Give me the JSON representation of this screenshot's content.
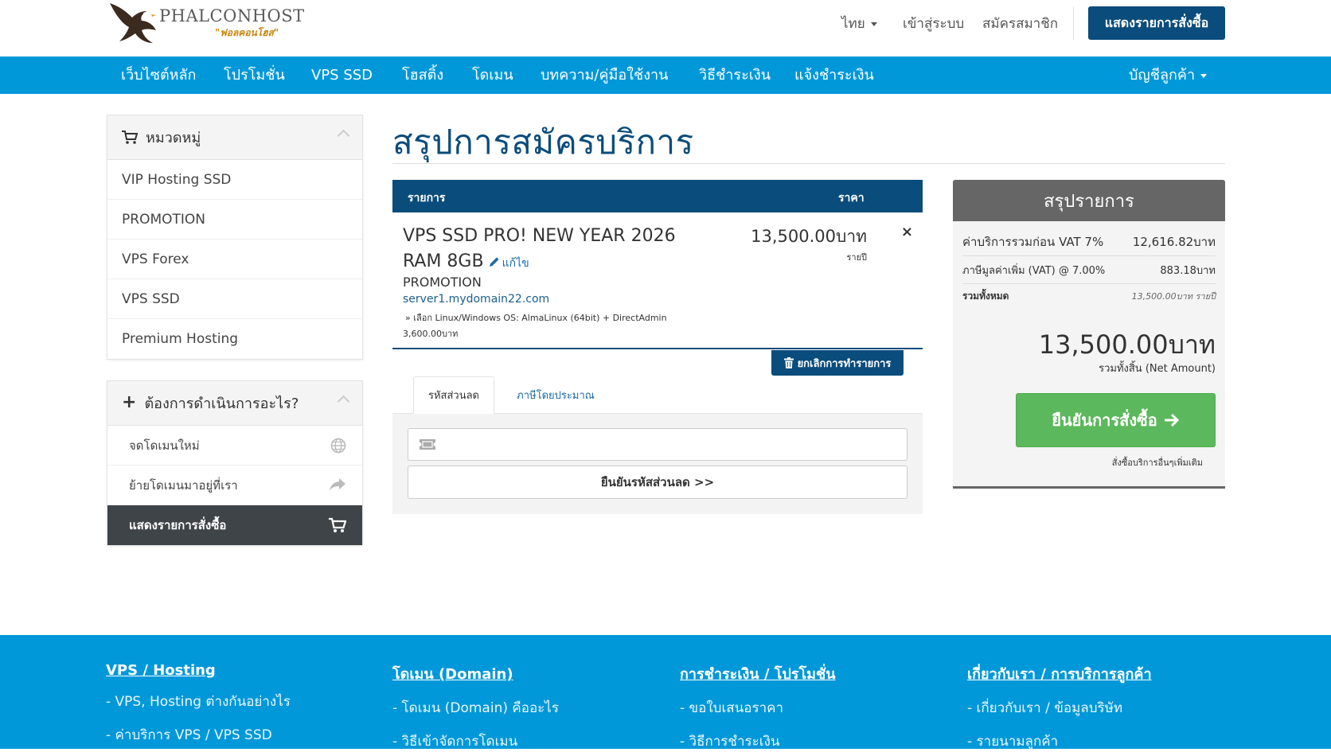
{
  "header": {
    "logo_name": "PHALCONHOST",
    "logo_tagline": "\"ฟอลคอนโฮส\"",
    "language": "ไทย",
    "login": "เข้าสู่ระบบ",
    "register": "สมัครสมาชิก",
    "view_cart": "แสดงรายการสั่งซื้อ"
  },
  "nav": {
    "items": [
      "เว็บไซต์หลัก",
      "โปรโมชั่น",
      "VPS SSD",
      "โฮสติ้ง",
      "โดเมน",
      "บทความ/คู่มือใช้งาน",
      "วิธีชำระเงิน",
      "แจ้งชำระเงิน"
    ],
    "account": "บัญชีลูกค้า"
  },
  "sidebar": {
    "categories_title": "หมวดหมู่",
    "categories": [
      "VIP Hosting SSD",
      "PROMOTION",
      "VPS Forex",
      "VPS SSD",
      "Premium Hosting"
    ],
    "actions_title": "ต้องการดำเนินการอะไร?",
    "actions": [
      "จดโดเมนใหม่",
      "ย้ายโดเมนมาอยู่ที่เรา",
      "แสดงรายการสั่งซื้อ"
    ]
  },
  "main": {
    "title": "สรุปการสมัครบริการ",
    "col_item": "รายการ",
    "col_price": "ราคา",
    "item": {
      "name": "VPS SSD PRO! NEW YEAR 2026 RAM 8GB",
      "edit": "แก้ไข",
      "group": "PROMOTION",
      "domain": "server1.mydomain22.com",
      "option": "» เลือก Linux/Windows OS: AlmaLinux (64bit) + DirectAdmin",
      "option_price": "3,600.00บาท",
      "price": "13,500.00บาท",
      "cycle": "รายปี",
      "remove": "×"
    },
    "empty_cart": "ยกเลิกการทำรายการ",
    "tabs": [
      "รหัสส่วนลด",
      "ภาษีโดยประมาณ"
    ],
    "promo_placeholder": "",
    "promo_button": "ยืนยันรหัสส่วนลด >>"
  },
  "summary": {
    "title": "สรุปรายการ",
    "subtotal_label": "ค่าบริการรวมก่อน VAT 7%",
    "subtotal_value": "12,616.82บาท",
    "vat_label": "ภาษีมูลค่าเพิ่ม (VAT) @ 7.00%",
    "vat_value": "883.18บาท",
    "total_label": "รวมทั้งหมด",
    "total_value": "13,500.00บาท รายปี",
    "grand_total": "13,500.00บาท",
    "grand_label": "รวมทั้งสิ้น (Net Amount)",
    "checkout": "ยืนยันการสั่งซื้อ",
    "continue": "สั่งซื้อบริการอื่นๆเพิ่มเติม"
  },
  "footer": {
    "columns": [
      {
        "title": "VPS / Hosting",
        "links": [
          "- VPS, Hosting ต่างกันอย่างไร",
          "- ค่าบริการ VPS / VPS SSD"
        ]
      },
      {
        "title": "โดเมน (Domain)",
        "links": [
          "- โดเมน (Domain) คืออะไร",
          "- วิธีเข้าจัดการโดเมน"
        ]
      },
      {
        "title": "การชำระเงิน / โปรโมชั่น",
        "links": [
          "- ขอใบเสนอราคา",
          "- วิธีการชำระเงิน"
        ]
      },
      {
        "title": "เกี่ยวกับเรา / การบริการลูกค้า",
        "links": [
          "- เกี่ยวกับเรา / ข้อมูลบริษัท",
          "- รายนามลูกค้า"
        ]
      }
    ]
  },
  "colors": {
    "brand_dark": "#0a4c7c",
    "nav_blue": "#0098d9",
    "checkout_green": "#5cb85c",
    "summary_gray": "#666666"
  }
}
